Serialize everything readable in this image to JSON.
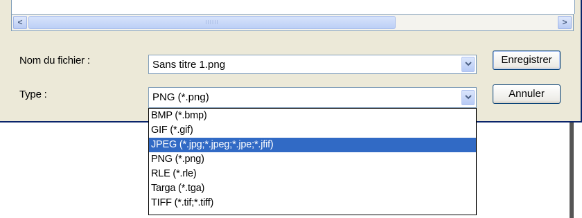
{
  "scrollbar": {
    "left_arrow": "<",
    "right_arrow": ">",
    "thumb_grip": "IIIIII"
  },
  "filename": {
    "label": "Nom du fichier :",
    "value": "Sans titre 1.png"
  },
  "type": {
    "label": "Type :",
    "value": "PNG (*.png)"
  },
  "buttons": {
    "save": "Enregistrer",
    "cancel": "Annuler"
  },
  "type_options": [
    "BMP (*.bmp)",
    "GIF (*.gif)",
    "JPEG (*.jpg;*.jpeg;*.jpe;*.jfif)",
    "PNG (*.png)",
    "RLE (*.rle)",
    "Targa (*.tga)",
    "TIFF (*.tif;*.tiff)"
  ],
  "selected_option_index": 2,
  "colors": {
    "dialog_bg": "#ece9d8",
    "selection": "#316ac5",
    "border": "#7f9db9"
  }
}
